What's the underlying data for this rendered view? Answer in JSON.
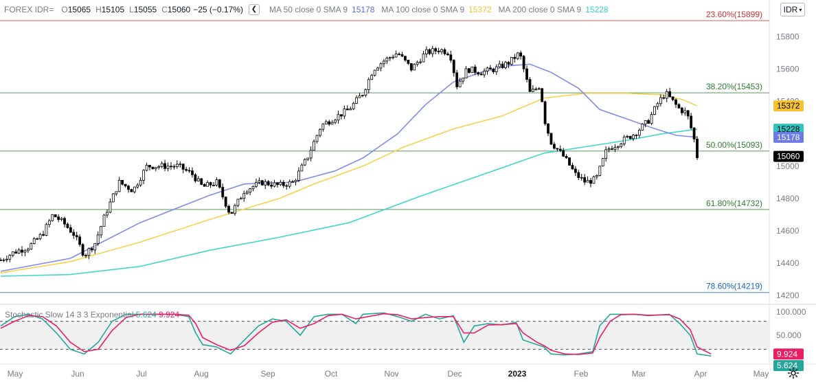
{
  "symbol": "FOREX IDR=",
  "ohlc": {
    "o": "15065",
    "h": "15105",
    "l": "15055",
    "c": "15060",
    "change": "−25 (−0.17%)"
  },
  "ma_items": [
    {
      "label": "MA 50 close 0 SMA 9",
      "value": "15178",
      "color": "#5b6ee1"
    },
    {
      "label": "MA 100 close 0 SMA 9",
      "value": "15372",
      "color": "#f2c230"
    },
    {
      "label": "MA 200 close 0 SMA 9",
      "value": "15228",
      "color": "#2fd1c8"
    }
  ],
  "currency_button": "IDR",
  "stochastic": {
    "label": "Stochastic Slow 14 3 3 Exponential",
    "k": "5.624",
    "d": "9.924",
    "k_color": "#26a69a",
    "d_color": "#e91e63"
  },
  "colors": {
    "ma50": "#7f8ce8",
    "ma100": "#f6d34a",
    "ma200": "#3fd6cc",
    "fib_red": "#d32f2f",
    "fib_green": "#2e7d32",
    "fib_blue": "#1565c0"
  },
  "chart_data": {
    "type": "candlestick",
    "price_axis": {
      "ticks": [
        14200,
        14400,
        14600,
        14800,
        15000,
        15200,
        15400,
        15600,
        15800
      ],
      "range": [
        14150,
        15950
      ]
    },
    "x_labels": [
      "May",
      "Jun",
      "Jul",
      "Aug",
      "Sep",
      "Oct",
      "Nov",
      "Dec",
      "2023",
      "Feb",
      "Mar",
      "Apr",
      "May"
    ],
    "fib_levels": [
      {
        "label": "23.60%(15899)",
        "value": 15899,
        "color": "#d32f2f"
      },
      {
        "label": "38.20%(15453)",
        "value": 15453,
        "color": "#2e7d32"
      },
      {
        "label": "50.00%(15093)",
        "value": 15093,
        "color": "#2e7d32"
      },
      {
        "label": "61.80%(14732)",
        "value": 14732,
        "color": "#2e7d32"
      },
      {
        "label": "78.60%(14219)",
        "value": 14219,
        "color": "#1565c0"
      }
    ],
    "price_tags": [
      {
        "value": "15372",
        "bg": "#f6c232",
        "fg": "#000000",
        "price": 15372
      },
      {
        "value": "15228",
        "bg": "#2fc4bc",
        "fg": "#000000",
        "price": 15228
      },
      {
        "value": "15178",
        "bg": "#6a7be6",
        "fg": "#ffffff",
        "price": 15178
      },
      {
        "value": "15060",
        "bg": "#000000",
        "fg": "#ffffff",
        "price": 15060
      }
    ],
    "close_path": [
      [
        0,
        14420
      ],
      [
        0.02,
        14470
      ],
      [
        0.04,
        14500
      ],
      [
        0.06,
        14580
      ],
      [
        0.075,
        14700
      ],
      [
        0.09,
        14650
      ],
      [
        0.105,
        14580
      ],
      [
        0.12,
        14450
      ],
      [
        0.135,
        14520
      ],
      [
        0.15,
        14700
      ],
      [
        0.17,
        14900
      ],
      [
        0.19,
        14850
      ],
      [
        0.21,
        15000
      ],
      [
        0.23,
        15000
      ],
      [
        0.255,
        15000
      ],
      [
        0.275,
        14950
      ],
      [
        0.29,
        14870
      ],
      [
        0.31,
        14900
      ],
      [
        0.33,
        14700
      ],
      [
        0.35,
        14850
      ],
      [
        0.375,
        14900
      ],
      [
        0.4,
        14880
      ],
      [
        0.42,
        14900
      ],
      [
        0.44,
        15050
      ],
      [
        0.46,
        15250
      ],
      [
        0.48,
        15300
      ],
      [
        0.5,
        15350
      ],
      [
        0.52,
        15450
      ],
      [
        0.535,
        15600
      ],
      [
        0.55,
        15650
      ],
      [
        0.57,
        15700
      ],
      [
        0.59,
        15600
      ],
      [
        0.61,
        15700
      ],
      [
        0.63,
        15720
      ],
      [
        0.645,
        15700
      ],
      [
        0.655,
        15500
      ],
      [
        0.67,
        15600
      ],
      [
        0.69,
        15580
      ],
      [
        0.71,
        15600
      ],
      [
        0.73,
        15640
      ],
      [
        0.745,
        15700
      ],
      [
        0.76,
        15450
      ],
      [
        0.775,
        15500
      ],
      [
        0.78,
        15300
      ],
      [
        0.79,
        15150
      ],
      [
        0.8,
        15100
      ],
      [
        0.81,
        15050
      ],
      [
        0.825,
        14950
      ],
      [
        0.84,
        14900
      ],
      [
        0.855,
        14920
      ],
      [
        0.87,
        15100
      ],
      [
        0.89,
        15150
      ],
      [
        0.91,
        15200
      ],
      [
        0.93,
        15280
      ],
      [
        0.945,
        15400
      ],
      [
        0.955,
        15450
      ],
      [
        0.965,
        15400
      ],
      [
        0.975,
        15350
      ],
      [
        0.985,
        15330
      ],
      [
        0.995,
        15180
      ],
      [
        1.0,
        15060
      ]
    ],
    "ma50_path": [
      [
        0,
        14350
      ],
      [
        0.1,
        14430
      ],
      [
        0.2,
        14650
      ],
      [
        0.3,
        14820
      ],
      [
        0.35,
        14890
      ],
      [
        0.42,
        14900
      ],
      [
        0.48,
        14970
      ],
      [
        0.52,
        15050
      ],
      [
        0.57,
        15200
      ],
      [
        0.61,
        15380
      ],
      [
        0.65,
        15520
      ],
      [
        0.69,
        15580
      ],
      [
        0.73,
        15620
      ],
      [
        0.76,
        15630
      ],
      [
        0.79,
        15580
      ],
      [
        0.83,
        15480
      ],
      [
        0.86,
        15350
      ],
      [
        0.9,
        15290
      ],
      [
        0.94,
        15230
      ],
      [
        0.97,
        15190
      ],
      [
        1.0,
        15178
      ]
    ],
    "ma100_path": [
      [
        0,
        14340
      ],
      [
        0.1,
        14410
      ],
      [
        0.2,
        14530
      ],
      [
        0.3,
        14670
      ],
      [
        0.4,
        14800
      ],
      [
        0.45,
        14890
      ],
      [
        0.52,
        15000
      ],
      [
        0.58,
        15120
      ],
      [
        0.65,
        15230
      ],
      [
        0.72,
        15310
      ],
      [
        0.78,
        15420
      ],
      [
        0.84,
        15450
      ],
      [
        0.9,
        15450
      ],
      [
        0.95,
        15440
      ],
      [
        0.98,
        15410
      ],
      [
        1.0,
        15372
      ]
    ],
    "ma200_path": [
      [
        0,
        14320
      ],
      [
        0.1,
        14330
      ],
      [
        0.2,
        14380
      ],
      [
        0.3,
        14480
      ],
      [
        0.4,
        14560
      ],
      [
        0.5,
        14650
      ],
      [
        0.6,
        14810
      ],
      [
        0.7,
        14960
      ],
      [
        0.78,
        15080
      ],
      [
        0.84,
        15120
      ],
      [
        0.9,
        15160
      ],
      [
        0.95,
        15200
      ],
      [
        1.0,
        15228
      ]
    ],
    "stoch_axis": {
      "ticks": [
        "100.000",
        "50.000"
      ],
      "range": [
        0,
        100
      ]
    },
    "stoch_k_path": [
      [
        0,
        70
      ],
      [
        0.02,
        90
      ],
      [
        0.04,
        95
      ],
      [
        0.06,
        85
      ],
      [
        0.08,
        55
      ],
      [
        0.1,
        20
      ],
      [
        0.12,
        10
      ],
      [
        0.14,
        35
      ],
      [
        0.16,
        80
      ],
      [
        0.18,
        95
      ],
      [
        0.2,
        95
      ],
      [
        0.25,
        95
      ],
      [
        0.27,
        90
      ],
      [
        0.28,
        55
      ],
      [
        0.29,
        30
      ],
      [
        0.31,
        25
      ],
      [
        0.33,
        10
      ],
      [
        0.35,
        40
      ],
      [
        0.37,
        70
      ],
      [
        0.39,
        85
      ],
      [
        0.41,
        80
      ],
      [
        0.43,
        50
      ],
      [
        0.45,
        90
      ],
      [
        0.47,
        95
      ],
      [
        0.49,
        95
      ],
      [
        0.51,
        75
      ],
      [
        0.52,
        95
      ],
      [
        0.55,
        98
      ],
      [
        0.57,
        90
      ],
      [
        0.59,
        80
      ],
      [
        0.61,
        95
      ],
      [
        0.63,
        85
      ],
      [
        0.65,
        92
      ],
      [
        0.665,
        35
      ],
      [
        0.68,
        70
      ],
      [
        0.7,
        75
      ],
      [
        0.72,
        72
      ],
      [
        0.74,
        78
      ],
      [
        0.75,
        40
      ],
      [
        0.77,
        30
      ],
      [
        0.78,
        25
      ],
      [
        0.79,
        10
      ],
      [
        0.81,
        8
      ],
      [
        0.83,
        10
      ],
      [
        0.85,
        15
      ],
      [
        0.86,
        70
      ],
      [
        0.875,
        95
      ],
      [
        0.89,
        95
      ],
      [
        0.91,
        95
      ],
      [
        0.93,
        92
      ],
      [
        0.96,
        95
      ],
      [
        0.975,
        75
      ],
      [
        0.99,
        50
      ],
      [
        1.0,
        10
      ],
      [
        1.02,
        5.6
      ]
    ],
    "stoch_d_path": [
      [
        0,
        65
      ],
      [
        0.02,
        80
      ],
      [
        0.04,
        92
      ],
      [
        0.06,
        90
      ],
      [
        0.08,
        70
      ],
      [
        0.1,
        35
      ],
      [
        0.12,
        15
      ],
      [
        0.14,
        20
      ],
      [
        0.16,
        60
      ],
      [
        0.18,
        88
      ],
      [
        0.2,
        95
      ],
      [
        0.25,
        95
      ],
      [
        0.27,
        93
      ],
      [
        0.28,
        75
      ],
      [
        0.29,
        45
      ],
      [
        0.31,
        30
      ],
      [
        0.33,
        18
      ],
      [
        0.35,
        28
      ],
      [
        0.37,
        55
      ],
      [
        0.39,
        78
      ],
      [
        0.41,
        83
      ],
      [
        0.43,
        65
      ],
      [
        0.45,
        75
      ],
      [
        0.47,
        92
      ],
      [
        0.49,
        95
      ],
      [
        0.51,
        85
      ],
      [
        0.52,
        88
      ],
      [
        0.55,
        96
      ],
      [
        0.57,
        94
      ],
      [
        0.59,
        85
      ],
      [
        0.61,
        88
      ],
      [
        0.63,
        90
      ],
      [
        0.65,
        90
      ],
      [
        0.665,
        55
      ],
      [
        0.68,
        55
      ],
      [
        0.7,
        72
      ],
      [
        0.72,
        73
      ],
      [
        0.74,
        75
      ],
      [
        0.75,
        55
      ],
      [
        0.77,
        35
      ],
      [
        0.78,
        28
      ],
      [
        0.79,
        18
      ],
      [
        0.81,
        10
      ],
      [
        0.83,
        9
      ],
      [
        0.85,
        12
      ],
      [
        0.86,
        45
      ],
      [
        0.875,
        80
      ],
      [
        0.89,
        94
      ],
      [
        0.91,
        95
      ],
      [
        0.93,
        93
      ],
      [
        0.96,
        94
      ],
      [
        0.975,
        85
      ],
      [
        0.99,
        62
      ],
      [
        1.0,
        25
      ],
      [
        1.02,
        9.9
      ]
    ]
  }
}
